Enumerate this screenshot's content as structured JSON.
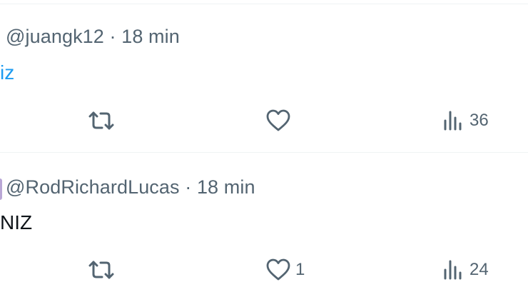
{
  "tweets": [
    {
      "handle": "@juangk12",
      "separator": "·",
      "time": "18 min",
      "text": "iz",
      "likes": "",
      "views": "36"
    },
    {
      "handle": "@RodRichardLucas",
      "separator": "·",
      "time": "18 min",
      "text": "NIZ",
      "likes": "1",
      "views": "24"
    }
  ],
  "icons": {
    "retweet": "retweet-icon",
    "like": "heart-icon",
    "views": "views-chart-icon"
  },
  "colors": {
    "muted": "#536471",
    "link": "#1d9bf0",
    "text": "#0f1419",
    "divider": "#eff3f4"
  }
}
